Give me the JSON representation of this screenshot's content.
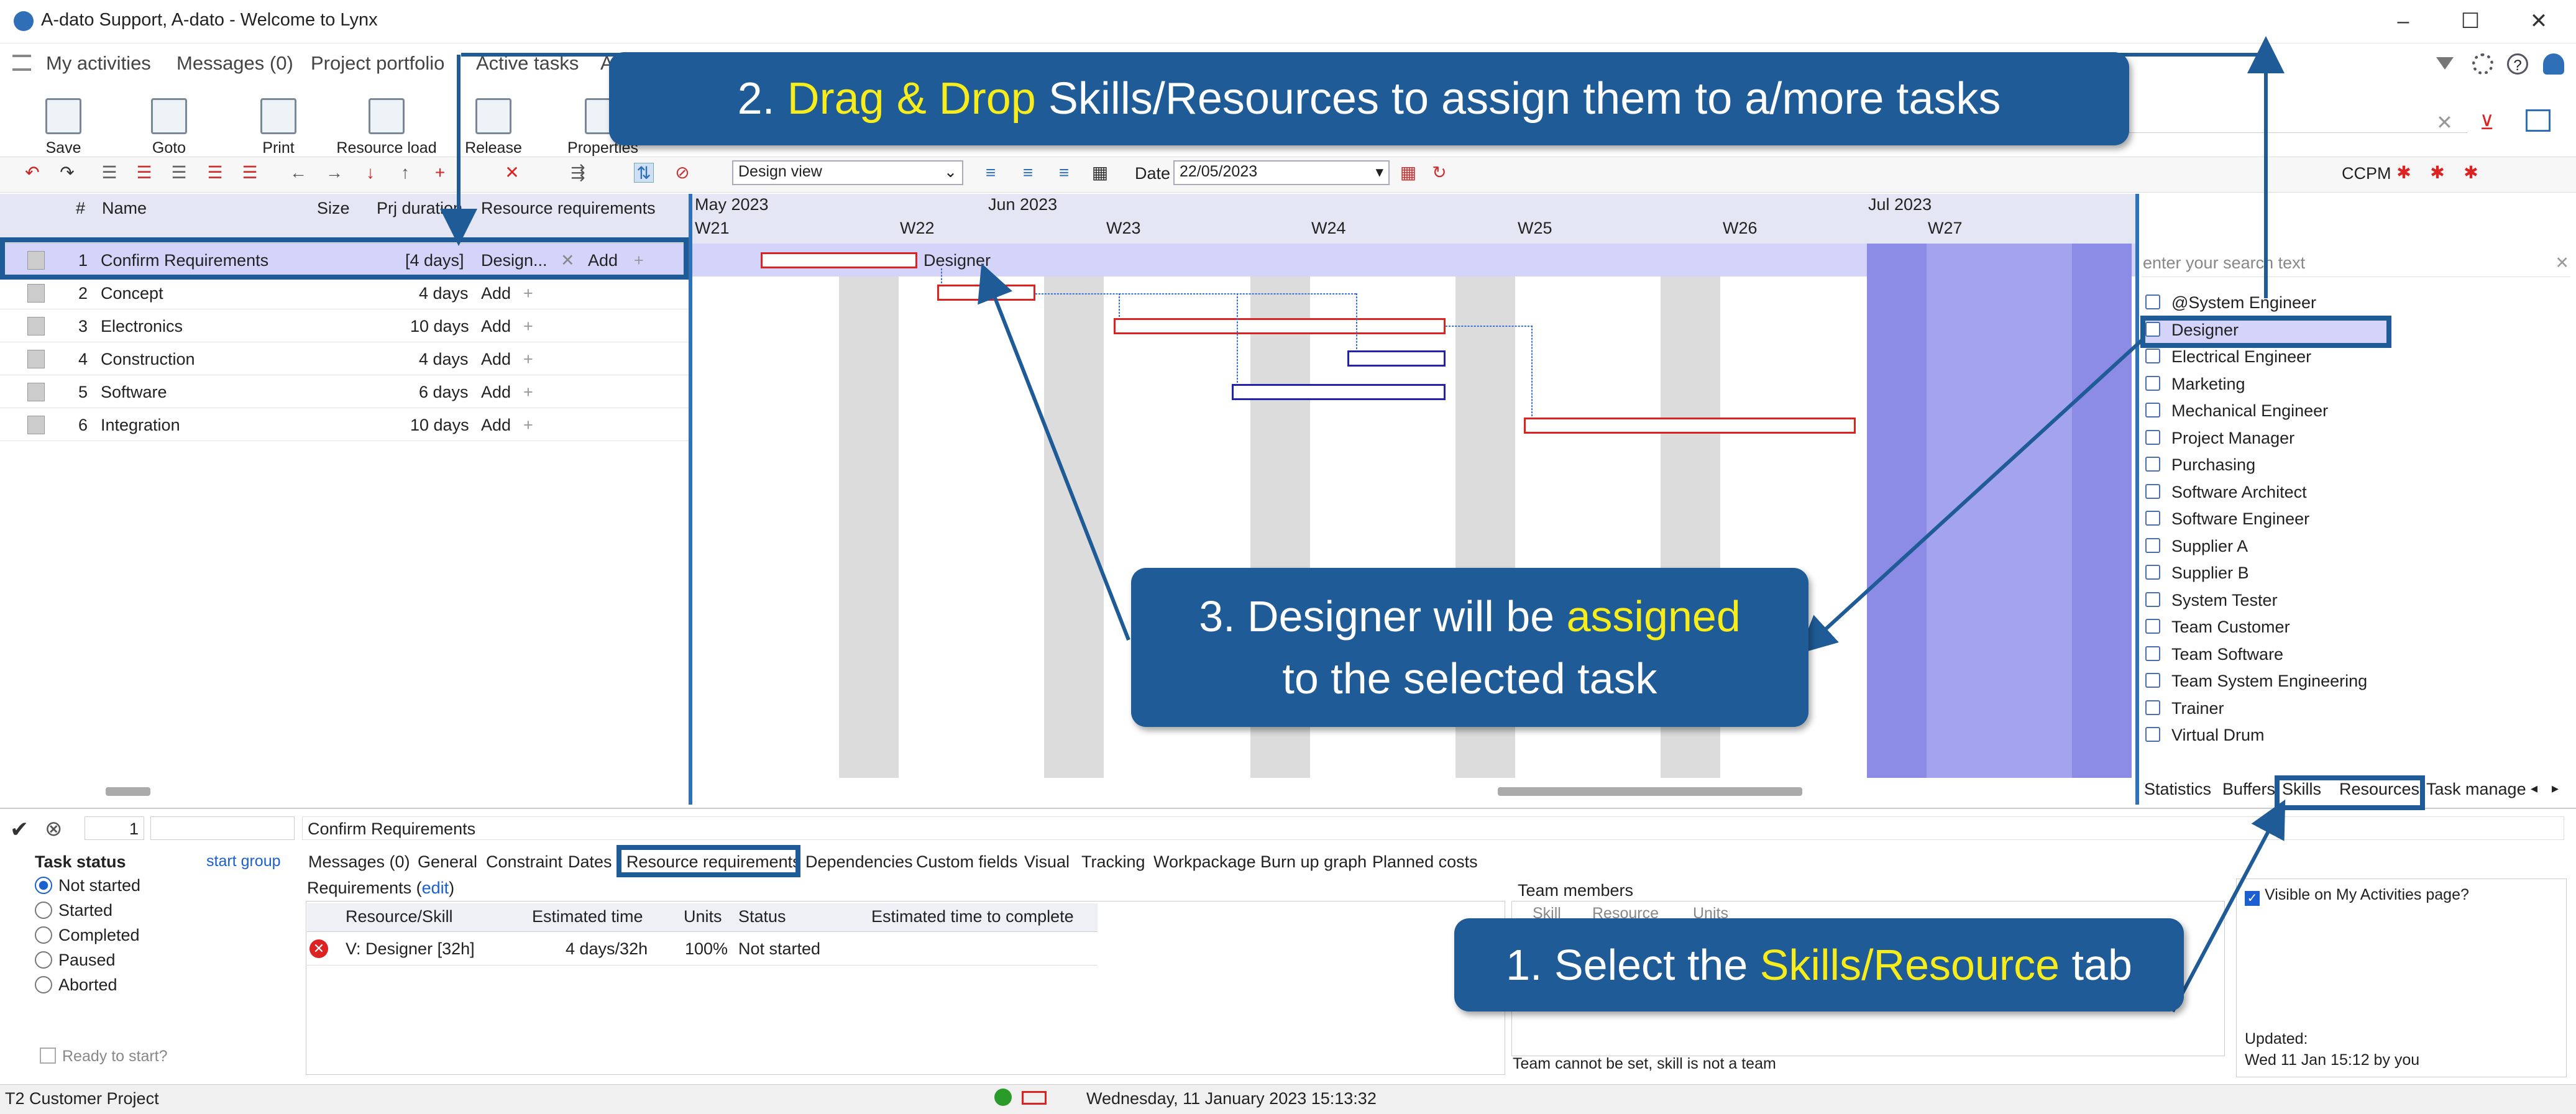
{
  "window": {
    "title": "A-dato Support, A-dato - Welcome to Lynx",
    "controls": [
      "–",
      "☐",
      "✕"
    ]
  },
  "menu": [
    "My activities",
    "Messages (0)",
    "Project portfolio",
    "Active tasks",
    "A"
  ],
  "toolbar": {
    "buttons": [
      "Save",
      "Goto",
      "Print",
      "Resource load",
      "Release",
      "Properties"
    ],
    "view_select": "Design view",
    "date_label": "Date",
    "date_value": "22/05/2023",
    "ccpm": "CCPM"
  },
  "grid": {
    "headers": {
      "num": "#",
      "name": "Name",
      "size": "Size",
      "duration": "Prj duration",
      "resreq": "Resource requirements"
    },
    "rows": [
      {
        "num": "1",
        "name": "Confirm Requirements",
        "duration": "[4 days]",
        "resreq": "Design...",
        "add": "Add"
      },
      {
        "num": "2",
        "name": "Concept",
        "duration": "4 days",
        "resreq": "",
        "add": "Add"
      },
      {
        "num": "3",
        "name": "Electronics",
        "duration": "10 days",
        "resreq": "",
        "add": "Add"
      },
      {
        "num": "4",
        "name": "Construction",
        "duration": "4 days",
        "resreq": "",
        "add": "Add"
      },
      {
        "num": "5",
        "name": "Software",
        "duration": "6 days",
        "resreq": "",
        "add": "Add"
      },
      {
        "num": "6",
        "name": "Integration",
        "duration": "10 days",
        "resreq": "",
        "add": "Add"
      }
    ]
  },
  "gantt": {
    "months": [
      "May 2023",
      "Jun 2023",
      "Jul 2023"
    ],
    "weeks": [
      "W21",
      "W22",
      "W23",
      "W24",
      "W25",
      "W26",
      "W27"
    ],
    "bar_label": "Designer"
  },
  "right_panel": {
    "search_placeholder": "enter your search text",
    "skills": [
      "@System Engineer",
      "Designer",
      "Electrical Engineer",
      "Marketing",
      "Mechanical Engineer",
      "Project Manager",
      "Purchasing",
      "Software Architect",
      "Software Engineer",
      "Supplier A",
      "Supplier B",
      "System Tester",
      "Team Customer",
      "Team Software",
      "Team System Engineering",
      "Trainer",
      "Virtual Drum"
    ],
    "tabs": [
      "Statistics",
      "Buffers",
      "Skills",
      "Resources",
      "Task manage"
    ]
  },
  "bottom": {
    "task_num": "1",
    "task_name": "Confirm Requirements",
    "task_status_label": "Task status",
    "start_group": "start group",
    "statuses": [
      "Not started",
      "Started",
      "Completed",
      "Paused",
      "Aborted"
    ],
    "ready": "Ready to start?",
    "tabs": [
      "Messages (0)",
      "General",
      "Constraint",
      "Dates",
      "Resource requirements",
      "Dependencies",
      "Custom fields",
      "Visual",
      "Tracking",
      "Workpackage",
      "Burn up graph",
      "Planned costs"
    ],
    "requirements_label": "Requirements",
    "edit": "edit",
    "req_headers": [
      "Resource/Skill",
      "Estimated time",
      "Units",
      "Status",
      "Estimated time to complete"
    ],
    "req_row": {
      "skill": "V: Designer [32h]",
      "time": "4 days/32h",
      "units": "100%",
      "status": "Not started",
      "etc": ""
    },
    "team_members": "Team members",
    "team_headers": [
      "Skill",
      "Resource",
      "Units"
    ],
    "team_note": "Team cannot be set, skill is not a team",
    "visible_label": "Visible on My Activities page?",
    "updated_label": "Updated:",
    "updated_value": "Wed 11 Jan 15:12 by you"
  },
  "statusbar": {
    "project": "T2 Customer Project",
    "datetime": "Wednesday, 11 January 2023 15:13:32"
  },
  "callouts": {
    "c1": {
      "num": "1.",
      "a": "Select the",
      "hl": "Skills/Resource",
      "b": "tab"
    },
    "c2": {
      "num": "2.",
      "hl": "Drag & Drop",
      "b": "Skills/Resources to assign them to a/more tasks"
    },
    "c3": {
      "line1a": "3. Designer will be",
      "hl": "assigned",
      "line2": "to the selected task"
    }
  },
  "colors": {
    "callout_bg": "#1f5b96",
    "highlight": "#f7ec1c",
    "selection": "#d4d4fb"
  }
}
